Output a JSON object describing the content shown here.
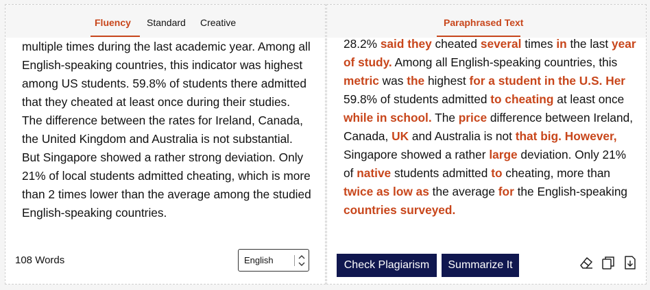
{
  "left_panel": {
    "tabs": [
      {
        "label": "Fluency"
      },
      {
        "label": "Standard"
      },
      {
        "label": "Creative"
      }
    ],
    "text": "multiple times during the last academic year. Among all English-speaking countries, this indicator was highest among US students. 59.8% of students there admitted that they cheated at least once during their studies. The difference between the rates for Ireland, Canada, the United Kingdom and Australia is not substantial. But Singapore showed a rather strong deviation. Only 21% of local students admitted cheating, which is more than 2 times lower than the average among the studied English-speaking countries.",
    "word_count": "108 Words",
    "language": "English"
  },
  "right_panel": {
    "title": "Paraphrased Text",
    "segments": [
      {
        "t": "28.2% ",
        "h": false
      },
      {
        "t": "said they",
        "h": true
      },
      {
        "t": " cheated ",
        "h": false
      },
      {
        "t": "several",
        "h": true
      },
      {
        "t": " times ",
        "h": false
      },
      {
        "t": "in",
        "h": true
      },
      {
        "t": " the last ",
        "h": false
      },
      {
        "t": "year of study.",
        "h": true
      },
      {
        "t": " Among all English-speaking countries, this ",
        "h": false
      },
      {
        "t": "metric",
        "h": true
      },
      {
        "t": " was ",
        "h": false
      },
      {
        "t": "the",
        "h": true
      },
      {
        "t": " highest ",
        "h": false
      },
      {
        "t": "for a student in the U.S. Her",
        "h": true
      },
      {
        "t": " 59.8% of students  admitted ",
        "h": false
      },
      {
        "t": "to cheating",
        "h": true
      },
      {
        "t": " at least once ",
        "h": false
      },
      {
        "t": "while in school.",
        "h": true
      },
      {
        "t": " The ",
        "h": false
      },
      {
        "t": "price",
        "h": true
      },
      {
        "t": " difference between  Ireland, Canada, ",
        "h": false
      },
      {
        "t": "UK",
        "h": true
      },
      {
        "t": " and Australia is not ",
        "h": false
      },
      {
        "t": "that big. However,",
        "h": true
      },
      {
        "t": " Singapore showed a rather ",
        "h": false
      },
      {
        "t": "large",
        "h": true
      },
      {
        "t": " deviation. Only 21% of ",
        "h": false
      },
      {
        "t": "native",
        "h": true
      },
      {
        "t": " students admitted ",
        "h": false
      },
      {
        "t": "to",
        "h": true
      },
      {
        "t": " cheating,  more than ",
        "h": false
      },
      {
        "t": "twice as low as",
        "h": true
      },
      {
        "t": " the average ",
        "h": false
      },
      {
        "t": "for",
        "h": true
      },
      {
        "t": " the  English-speaking ",
        "h": false
      },
      {
        "t": "countries surveyed.",
        "h": true
      }
    ],
    "buttons": {
      "check_plagiarism": "Check Plagiarism",
      "summarize": "Summarize It"
    },
    "icons": [
      "eraser-icon",
      "copy-icon",
      "download-icon"
    ]
  },
  "colors": {
    "accent": "#c8461b",
    "button_bg": "#10174f"
  }
}
